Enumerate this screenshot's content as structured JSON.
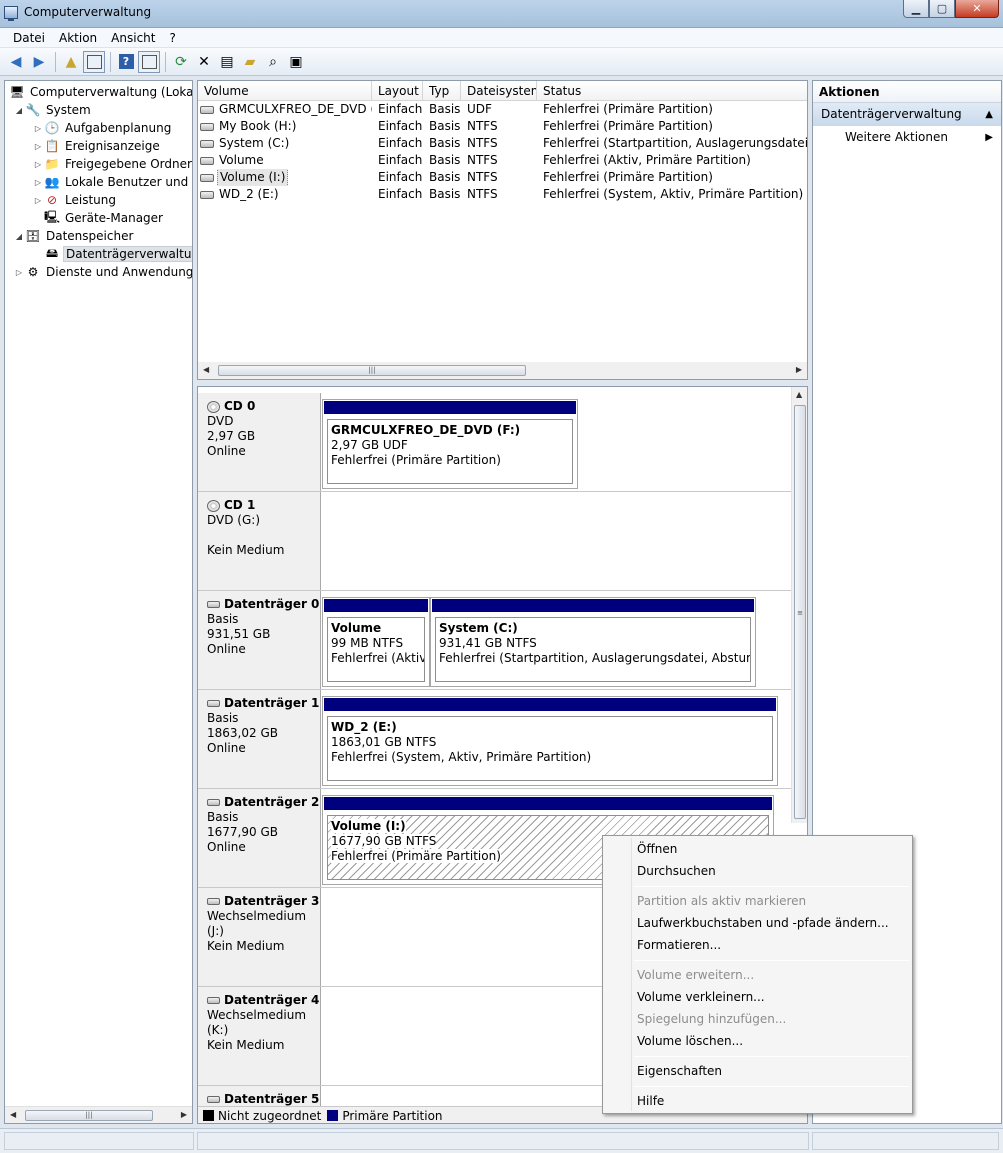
{
  "window": {
    "title": "Computerverwaltung"
  },
  "menu": [
    "Datei",
    "Aktion",
    "Ansicht",
    "?"
  ],
  "toolbar_icons": [
    "back-arrow-icon",
    "forward-arrow-icon",
    "folder-up-icon",
    "console-tree-icon",
    "help-icon",
    "action-pane-icon",
    "refresh-icon",
    "delete-icon",
    "properties-icon",
    "open-folder-icon",
    "search-icon",
    "disk-settings-icon"
  ],
  "tree": {
    "root": "Computerverwaltung (Lokal)",
    "system": "System",
    "aufgaben": "Aufgabenplanung",
    "ereignis": "Ereignisanzeige",
    "ordner": "Freigegebene Ordner",
    "benutzer": "Lokale Benutzer und Gruppen",
    "leistung": "Leistung",
    "geraete": "Geräte-Manager",
    "datenspeicher": "Datenspeicher",
    "dtv": "Datenträgerverwaltung",
    "dienste": "Dienste und Anwendungen"
  },
  "volume_list": {
    "columns": [
      "Volume",
      "Layout",
      "Typ",
      "Dateisystem",
      "Status"
    ],
    "rows": [
      {
        "volume": "GRMCULXFREO_DE_DVD (F:)",
        "layout": "Einfach",
        "typ": "Basis",
        "fs": "UDF",
        "status": "Fehlerfrei (Primäre Partition)"
      },
      {
        "volume": "My Book (H:)",
        "layout": "Einfach",
        "typ": "Basis",
        "fs": "NTFS",
        "status": "Fehlerfrei (Primäre Partition)"
      },
      {
        "volume": "System (C:)",
        "layout": "Einfach",
        "typ": "Basis",
        "fs": "NTFS",
        "status": "Fehlerfrei (Startpartition, Auslagerungsdatei, Absturzabbild)"
      },
      {
        "volume": "Volume",
        "layout": "Einfach",
        "typ": "Basis",
        "fs": "NTFS",
        "status": "Fehlerfrei (Aktiv, Primäre Partition)"
      },
      {
        "volume": "Volume (I:)",
        "layout": "Einfach",
        "typ": "Basis",
        "fs": "NTFS",
        "status": "Fehlerfrei (Primäre Partition)"
      },
      {
        "volume": "WD_2 (E:)",
        "layout": "Einfach",
        "typ": "Basis",
        "fs": "NTFS",
        "status": "Fehlerfrei (System, Aktiv, Primäre Partition)"
      }
    ]
  },
  "disks": [
    {
      "name": "CD 0",
      "type": "DVD",
      "size": "2,97 GB",
      "state": "Online",
      "partitions": [
        {
          "title": "GRMCULXFREO_DE_DVD  (F:)",
          "size": "2,97 GB UDF",
          "status": "Fehlerfrei (Primäre Partition)"
        }
      ]
    },
    {
      "name": "CD 1",
      "type": "DVD (G:)",
      "size": "",
      "state": "Kein Medium",
      "partitions": []
    },
    {
      "name": "Datenträger 0",
      "type": "Basis",
      "size": "931,51 GB",
      "state": "Online",
      "partitions": [
        {
          "title": "Volume",
          "size": "99 MB NTFS",
          "status": "Fehlerfrei (Aktiv, Primäre Partition)"
        },
        {
          "title": "System  (C:)",
          "size": "931,41 GB NTFS",
          "status": "Fehlerfrei (Startpartition, Auslagerungsdatei, Absturzabbild)"
        }
      ]
    },
    {
      "name": "Datenträger 1",
      "type": "Basis",
      "size": "1863,02 GB",
      "state": "Online",
      "partitions": [
        {
          "title": "WD_2  (E:)",
          "size": "1863,01 GB NTFS",
          "status": "Fehlerfrei (System, Aktiv, Primäre Partition)"
        }
      ]
    },
    {
      "name": "Datenträger 2",
      "type": "Basis",
      "size": "1677,90 GB",
      "state": "Online",
      "partitions": [
        {
          "title": "Volume  (I:)",
          "size": "1677,90 GB NTFS",
          "status": "Fehlerfrei (Primäre Partition)"
        }
      ]
    },
    {
      "name": "Datenträger 3",
      "type": "Wechselmedium (J:)",
      "size": "",
      "state": "Kein Medium",
      "partitions": []
    },
    {
      "name": "Datenträger 4",
      "type": "Wechselmedium (K:)",
      "size": "",
      "state": "Kein Medium",
      "partitions": []
    },
    {
      "name": "Datenträger 5",
      "type": "",
      "size": "",
      "state": "",
      "partitions": []
    }
  ],
  "legend": {
    "unallocated": "Nicht zugeordnet",
    "primary": "Primäre Partition",
    "unallocated_color": "#000000",
    "primary_color": "#00007f"
  },
  "actions": {
    "header": "Aktionen",
    "section": "Datenträgerverwaltung",
    "more": "Weitere Aktionen"
  },
  "context_menu": {
    "items": [
      {
        "label": "Öffnen",
        "enabled": true
      },
      {
        "label": "Durchsuchen",
        "enabled": true
      },
      {
        "label": "Partition als aktiv markieren",
        "enabled": false
      },
      {
        "label": "Laufwerkbuchstaben und -pfade ändern...",
        "enabled": true
      },
      {
        "label": "Formatieren...",
        "enabled": true
      },
      {
        "label": "Volume erweitern...",
        "enabled": false
      },
      {
        "label": "Volume verkleinern...",
        "enabled": true
      },
      {
        "label": "Spiegelung hinzufügen...",
        "enabled": false
      },
      {
        "label": "Volume löschen...",
        "enabled": true
      },
      {
        "label": "Eigenschaften",
        "enabled": true
      },
      {
        "label": "Hilfe",
        "enabled": true
      }
    ]
  },
  "colors": {
    "partition_bar": "#00007f",
    "selection": "#c8d9ec"
  }
}
